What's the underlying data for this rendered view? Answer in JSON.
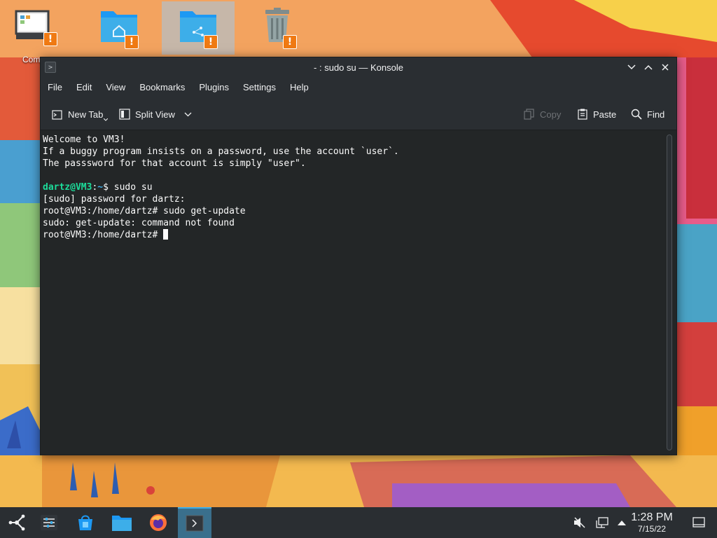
{
  "desktop": {
    "icons": [
      {
        "name": "computer",
        "label": "Comp",
        "warn": "!"
      },
      {
        "name": "home",
        "warn": "!"
      },
      {
        "name": "network",
        "warn": "!"
      },
      {
        "name": "trash",
        "warn": "!"
      }
    ]
  },
  "window": {
    "title": "- : sudo su — Konsole",
    "app_icon": ">"
  },
  "menu": [
    "File",
    "Edit",
    "View",
    "Bookmarks",
    "Plugins",
    "Settings",
    "Help"
  ],
  "toolbar": {
    "new_tab": "New Tab",
    "split_view": "Split View",
    "copy": "Copy",
    "paste": "Paste",
    "find": "Find"
  },
  "terminal": {
    "line1": "Welcome to VM3!",
    "line2": "If a buggy program insists on a password, use the account `user`.",
    "line3": "The passsword for that account is simply \"user\".",
    "prompt_user": "dartz@VM3",
    "prompt_sep": ":",
    "prompt_path": "~",
    "prompt_end": "$ ",
    "command1": "sudo su",
    "line5": "[sudo] password for dartz:",
    "line6": "root@VM3:/home/dartz# sudo get-update",
    "line7": "sudo: get-update: command not found",
    "line8": "root@VM3:/home/dartz# "
  },
  "clock": {
    "time": "1:28 PM",
    "date": "7/15/22"
  },
  "colors": {
    "accent": "#3daee9",
    "warning": "#f07a13",
    "prompt_user": "#1cdc9a"
  }
}
